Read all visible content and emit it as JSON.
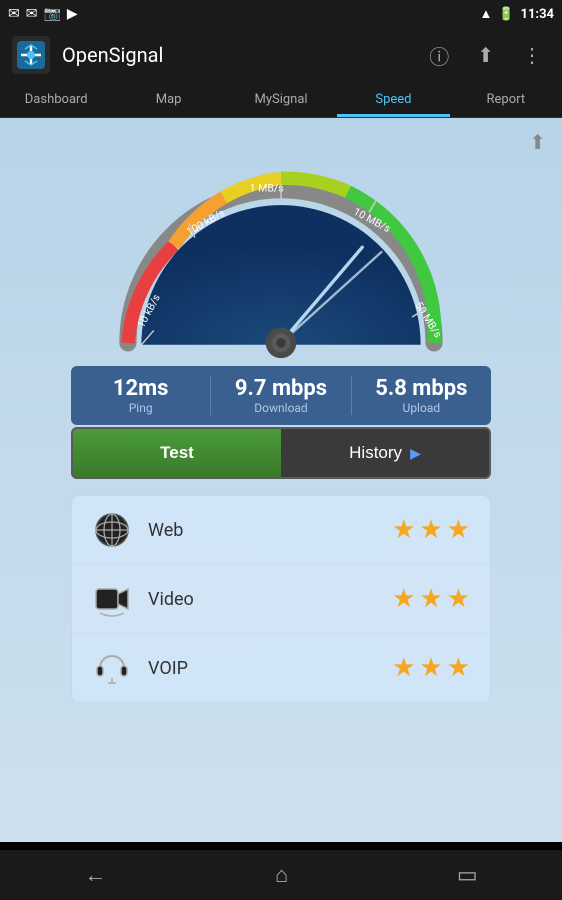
{
  "statusBar": {
    "time": "11:34",
    "icons": [
      "✉",
      "✉",
      "📷",
      "▶"
    ]
  },
  "actionBar": {
    "appName": "OpenSignal",
    "infoIcon": "ℹ",
    "shareIcon": "⬆",
    "menuIcon": "⋮"
  },
  "tabs": [
    {
      "label": "Dashboard",
      "active": false
    },
    {
      "label": "Map",
      "active": false
    },
    {
      "label": "MySignal",
      "active": false
    },
    {
      "label": "Speed",
      "active": true
    },
    {
      "label": "Report",
      "active": false
    }
  ],
  "speedometer": {
    "labels": [
      "10 kB/s",
      "100 kB/s",
      "1 MB/s",
      "10 MB/s",
      "50 MB/s"
    ]
  },
  "stats": {
    "ping": {
      "value": "12ms",
      "label": "Ping"
    },
    "download": {
      "value": "9.7 mbps",
      "label": "Download"
    },
    "upload": {
      "value": "5.8 mbps",
      "label": "Upload"
    }
  },
  "buttons": {
    "test": "Test",
    "history": "History"
  },
  "quality": [
    {
      "icon": "🌐",
      "label": "Web",
      "stars": 3
    },
    {
      "icon": "📹",
      "label": "Video",
      "stars": 3
    },
    {
      "icon": "🎧",
      "label": "VOIP",
      "stars": 3
    }
  ],
  "bottomNav": {
    "back": "←",
    "home": "⌂",
    "recent": "▭"
  }
}
